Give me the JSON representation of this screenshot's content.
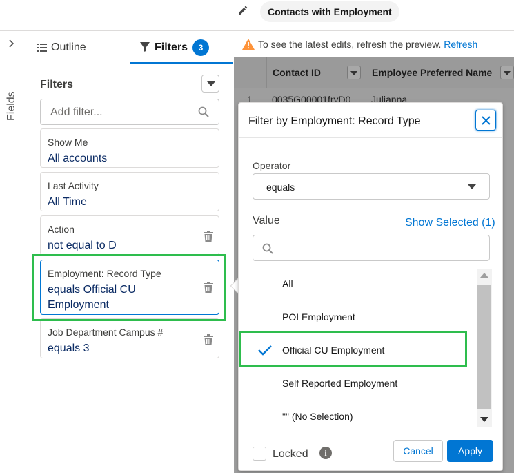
{
  "header": {
    "title": "Contacts with Employment",
    "edit_icon": "pencil-icon"
  },
  "fields_panel": {
    "label": "Fields"
  },
  "tabs": {
    "outline_label": "Outline",
    "filters_label": "Filters",
    "filters_count": "3"
  },
  "filters": {
    "heading": "Filters",
    "add_placeholder": "Add filter...",
    "cards": [
      {
        "label": "Show Me",
        "value": "All accounts"
      },
      {
        "label": "Last Activity",
        "value": "All Time"
      },
      {
        "label": "Action",
        "value": "not equal to D"
      },
      {
        "label": "Employment: Record Type",
        "value": "equals Official CU Employment"
      },
      {
        "label": "Job Department Campus #",
        "value": "equals 3"
      }
    ]
  },
  "preview": {
    "notice": "To see the latest edits, refresh the preview.",
    "refresh_link": "Refresh",
    "columns": [
      "Contact ID",
      "Employee Preferred Name"
    ],
    "rows": [
      {
        "num": "1",
        "contact_id": "0035G00001fryD0",
        "name": "Julianna"
      }
    ]
  },
  "popover": {
    "title": "Filter by Employment: Record Type",
    "operator_label": "Operator",
    "operator_value": "equals",
    "value_label": "Value",
    "show_selected": "Show Selected (1)",
    "options": [
      {
        "label": "All",
        "selected": false
      },
      {
        "label": "POI Employment",
        "selected": false
      },
      {
        "label": "Official CU Employment",
        "selected": true
      },
      {
        "label": "Self Reported Employment",
        "selected": false
      },
      {
        "label": "\"\" (No Selection)",
        "selected": false
      }
    ],
    "locked_label": "Locked",
    "cancel_label": "Cancel",
    "apply_label": "Apply"
  },
  "colors": {
    "brand": "#0176d3",
    "highlight": "#2ebd4d",
    "warning": "#fe9339"
  }
}
